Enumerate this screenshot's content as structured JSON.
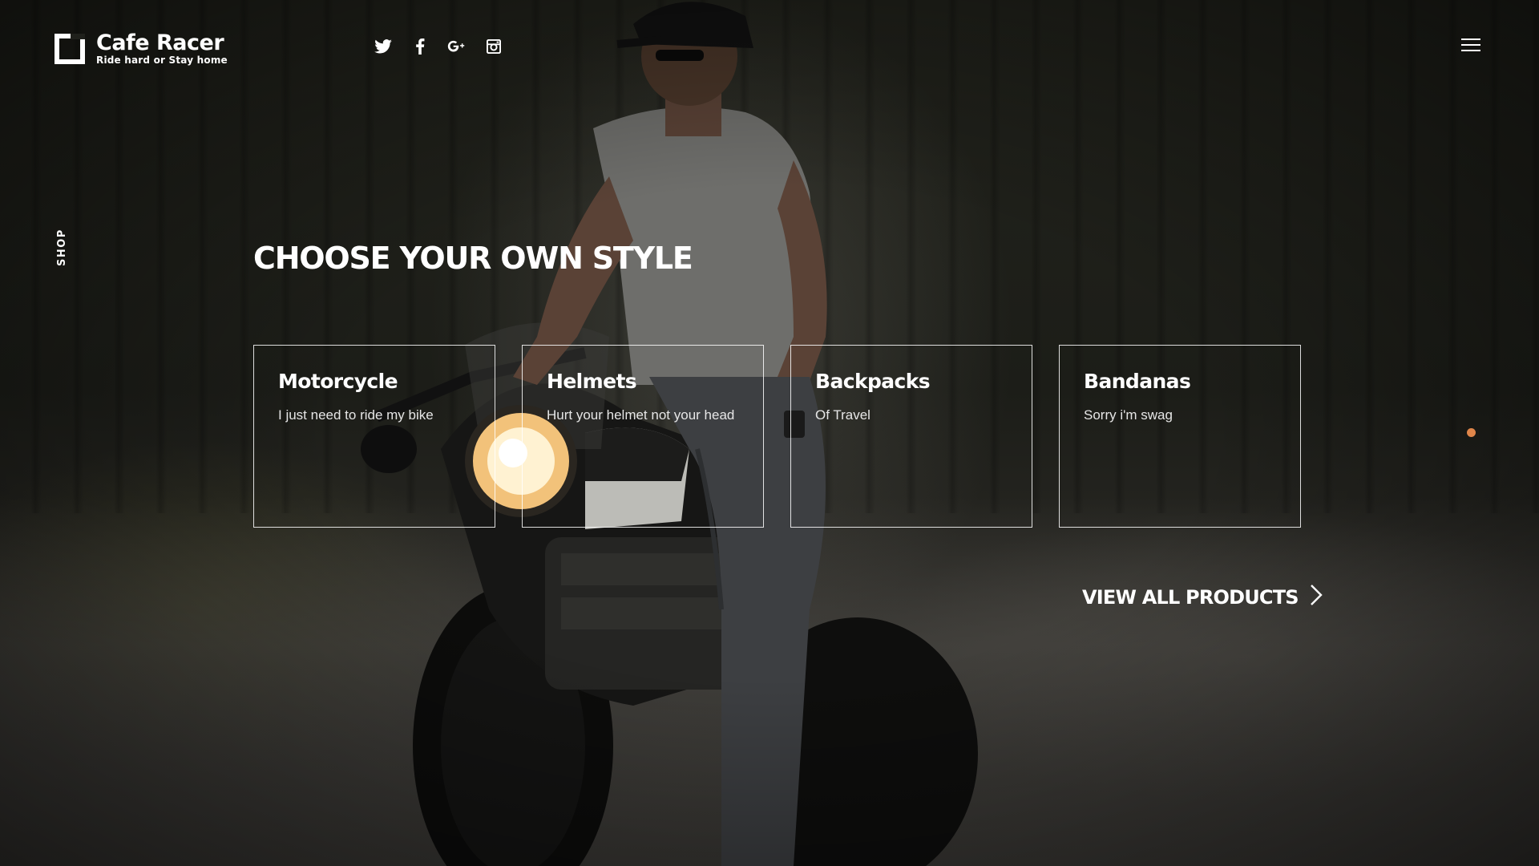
{
  "brand": {
    "title": "Cafe Racer",
    "tagline": "Ride hard or Stay home"
  },
  "social": [
    {
      "icon": "twitter-icon"
    },
    {
      "icon": "facebook-icon"
    },
    {
      "icon": "google-plus-icon"
    },
    {
      "icon": "instagram-icon"
    }
  ],
  "menu": {
    "icon": "hamburger-menu-icon"
  },
  "side_label": "SHOP",
  "headline": "CHOOSE YOUR OWN STYLE",
  "cards": [
    {
      "title": "Motorcycle",
      "description": "I just need to ride my bike"
    },
    {
      "title": "Helmets",
      "description": "Hurt your helmet not your head"
    },
    {
      "title": "Backpacks",
      "description": "Of Travel"
    },
    {
      "title": "Bandanas",
      "description": "Sorry i'm swag"
    }
  ],
  "view_all": {
    "label": "VIEW ALL PRODUCTS",
    "icon": "chevron-right-icon"
  },
  "colors": {
    "accent_dot": "#e0864a",
    "text": "#ffffff"
  }
}
